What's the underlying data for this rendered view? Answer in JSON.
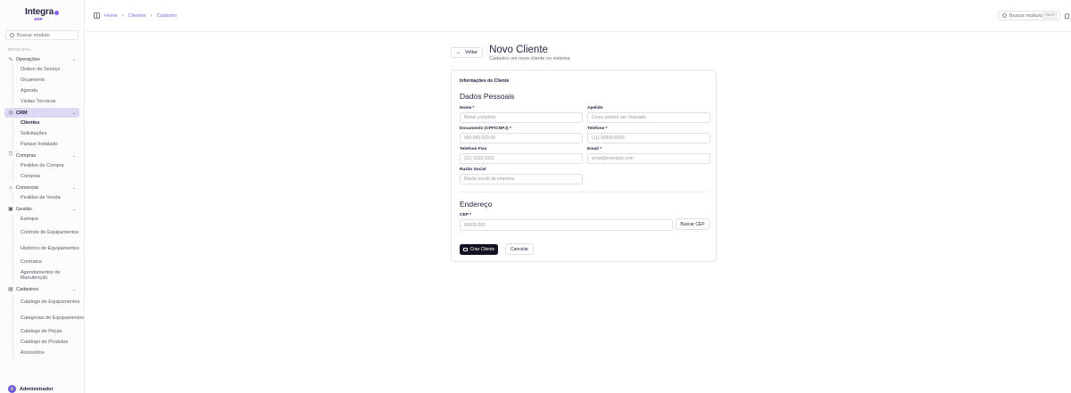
{
  "brand": {
    "name": "Integra",
    "sub": "ERP"
  },
  "sidebar": {
    "search_placeholder": "Buscar modulo",
    "section": "PRINCIPAL",
    "groups": [
      {
        "label": "Operações",
        "icon": "wave-icon",
        "items": [
          "Ordem de Serviço",
          "Orçamento",
          "Agenda",
          "Visitas Técnicas"
        ]
      },
      {
        "label": "CRM",
        "icon": "target-icon",
        "items": [
          "Clientes",
          "Solicitações",
          "Parque Instalado"
        ]
      },
      {
        "label": "Compras",
        "icon": "cart-icon",
        "items": [
          "Pedidos de Compra",
          "Compras"
        ]
      },
      {
        "label": "Comercial",
        "icon": "store-icon",
        "items": [
          "Pedidos de Venda"
        ]
      },
      {
        "label": "Gestão",
        "icon": "calendar-icon",
        "items": [
          "Estoque",
          "Controle de Equipamentos",
          "Histórico de Equipamentos",
          "Contratos",
          "Agendamentos de Manutenção"
        ]
      },
      {
        "label": "Cadastros",
        "icon": "document-icon",
        "items": [
          "Catálogo de Equipamentos",
          "Categorias de Equipamentos",
          "Catálogo de Peças",
          "Catálogo de Produtos",
          "Acessórios"
        ]
      }
    ],
    "user": {
      "initial": "A",
      "name": "Administrador"
    }
  },
  "topbar": {
    "breadcrumb": [
      "Home",
      "Clientes",
      "Cadastro"
    ],
    "search_placeholder": "Buscar modulo...",
    "shortcut": "Ctrl+K"
  },
  "page": {
    "back": "Voltar",
    "title": "Novo Cliente",
    "subtitle": "Cadastro um novo cliente no sistema"
  },
  "form": {
    "card_title": "Informações do Cliente",
    "section_personal": "Dados Pessoais",
    "fields": {
      "nome": {
        "label": "Nome *",
        "placeholder": "Nome completo"
      },
      "apelido": {
        "label": "Apelido",
        "placeholder": "Como prefere ser chamado"
      },
      "documento": {
        "label": "Documento (CPF/CNPJ) *",
        "placeholder": "000.000.000-00"
      },
      "telefone": {
        "label": "Telefone *",
        "placeholder": "(11) 99999-9999"
      },
      "telefone_fixo": {
        "label": "Telefone Fixo",
        "placeholder": "(11) 3333-3333"
      },
      "email": {
        "label": "Email *",
        "placeholder": "email@exemplo.com"
      },
      "razao_social": {
        "label": "Razão Social",
        "placeholder": "Razão social da empresa"
      },
      "cep": {
        "label": "CEP *",
        "placeholder": "00000-000"
      }
    },
    "section_address": "Endereço",
    "buscar_cep": "Buscar CEP",
    "submit": "Criar Cliente",
    "cancel": "Cancelar"
  }
}
